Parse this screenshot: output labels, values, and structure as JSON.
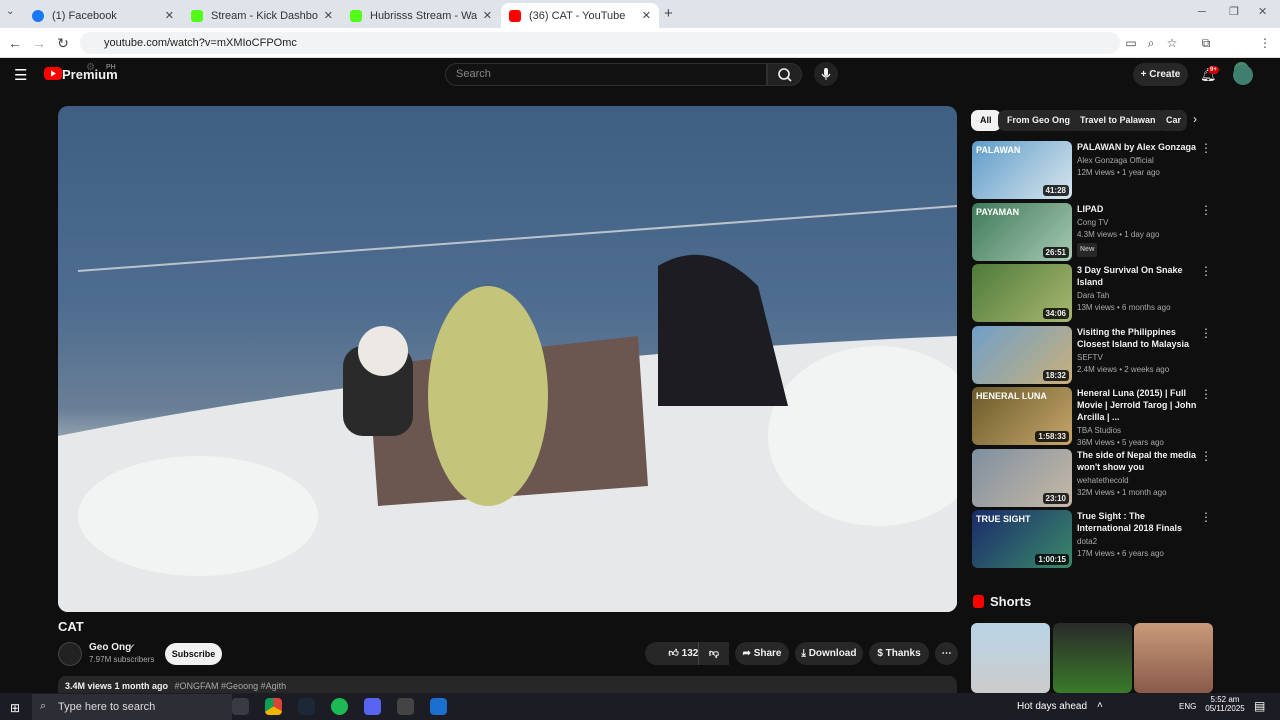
{
  "browser": {
    "tabs": [
      {
        "label": "(1) Facebook",
        "color": "#1877f2"
      },
      {
        "label": "Stream - Kick Dashboard",
        "color": "#53fc18"
      },
      {
        "label": "Hubrisss Stream - Watch Live o",
        "color": "#53fc18"
      },
      {
        "label": "(36) CAT - YouTube",
        "color": "#ff0000"
      }
    ],
    "url": "youtube.com/watch?v=mXMIoCFPOmc"
  },
  "header": {
    "logo": "Premium",
    "region": "PH",
    "search_placeholder": "Search",
    "create_label": "Create",
    "notif_count": "9+"
  },
  "video": {
    "title": "CAT",
    "channel": "Geo Ong",
    "subscribers": "7.97M subscribers",
    "subscribe_label": "Subscribe",
    "likes": "132K",
    "share_label": "Share",
    "download_label": "Download",
    "thanks_label": "Thanks",
    "desc_meta": "3.4M views  1 month ago",
    "desc_tags": "#ONGFAM #Geoong #Agith"
  },
  "chips": [
    "All",
    "From Geo Ong",
    "Travel to Palawan",
    "Car"
  ],
  "recommendations": [
    {
      "title": "PALAWAN by Alex Gonzaga",
      "channel": "Alex Gonzaga Official",
      "views": "12M views • 1 year ago",
      "duration": "41:28",
      "badge": "",
      "thumb_text": "PALAWAN",
      "c1": "#5f9cc7",
      "c2": "#d8e6ef"
    },
    {
      "title": "LIPAD",
      "channel": "Cong TV",
      "views": "4.3M views • 1 day ago",
      "duration": "26:51",
      "badge": "New",
      "thumb_text": "PAYAMAN",
      "c1": "#3f7a5a",
      "c2": "#a7c9b4"
    },
    {
      "title": "3 Day Survival On Snake Island",
      "channel": "Dara Tah",
      "views": "13M views • 6 months ago",
      "duration": "34:06",
      "badge": "",
      "thumb_text": "",
      "c1": "#4e7a3a",
      "c2": "#a8b870"
    },
    {
      "title": "Visiting the Philippines Closest Island to Malaysia",
      "channel": "SEFTV",
      "views": "2.4M views • 2 weeks ago",
      "duration": "18:32",
      "badge": "",
      "thumb_text": "",
      "c1": "#6f9fc9",
      "c2": "#c9b07a"
    },
    {
      "title": "Heneral Luna (2015) | Full Movie | Jerrold Tarog | John Arcilla | ...",
      "channel": "TBA Studios",
      "views": "36M views • 5 years ago",
      "duration": "1:58:33",
      "badge": "",
      "thumb_text": "HENERAL LUNA",
      "c1": "#6a5a2a",
      "c2": "#c6a66a"
    },
    {
      "title": "The side of Nepal the media won't show you",
      "channel": "wehatethecold",
      "views": "32M views • 1 month ago",
      "duration": "23:10",
      "badge": "",
      "thumb_text": "",
      "c1": "#7f8f9f",
      "c2": "#c7b9a7"
    },
    {
      "title": "True Sight : The International 2018 Finals",
      "channel": "dota2",
      "views": "17M views • 6 years ago",
      "duration": "1:00:15",
      "badge": "",
      "thumb_text": "TRUE SIGHT",
      "c1": "#1a2a6a",
      "c2": "#3a8a6a"
    }
  ],
  "shorts_label": "Shorts",
  "taskbar": {
    "search_placeholder": "Type here to search",
    "weather": "Hot days ahead",
    "lang": "ENG",
    "time": "5:52 am",
    "date": "05/11/2025"
  }
}
